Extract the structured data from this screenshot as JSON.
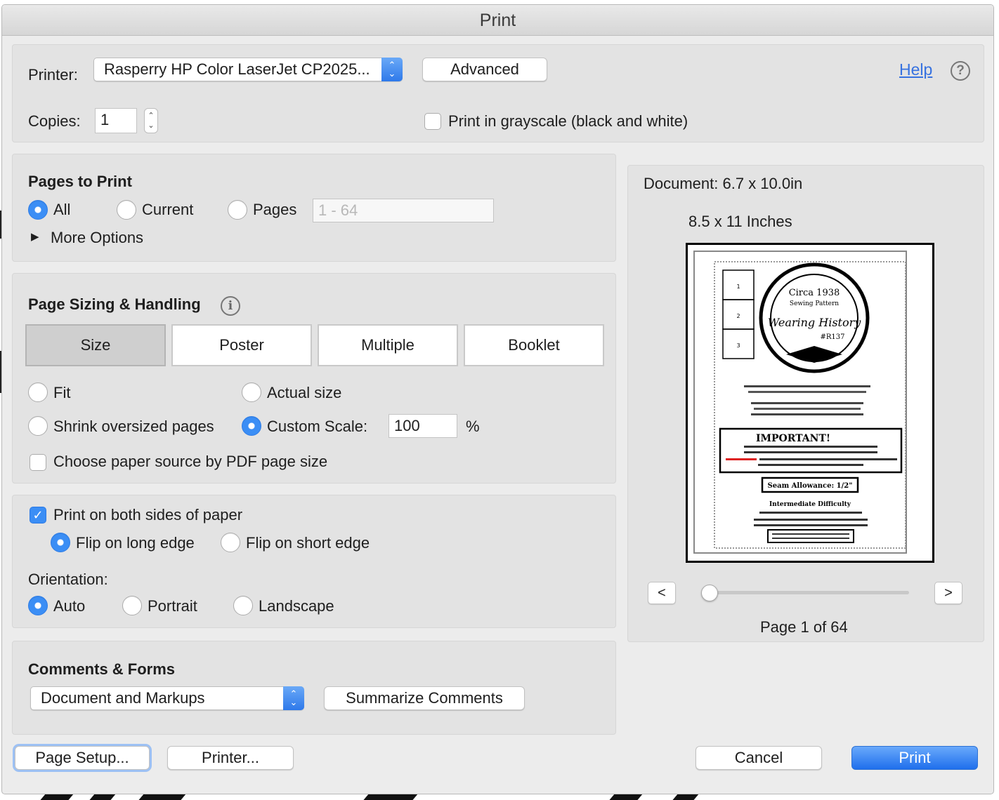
{
  "window": {
    "title": "Print"
  },
  "printer": {
    "label": "Printer:",
    "selected": "Rasperry HP Color LaserJet CP2025...",
    "advanced_label": "Advanced",
    "help_label": "Help",
    "copies_label": "Copies:",
    "copies_value": "1",
    "grayscale_label": "Print in grayscale (black and white)",
    "grayscale_checked": false
  },
  "pages_to_print": {
    "heading": "Pages to Print",
    "all_label": "All",
    "current_label": "Current",
    "pages_label": "Pages",
    "range_placeholder": "1 - 64",
    "selected": "All",
    "more_options_label": "More Options"
  },
  "sizing": {
    "heading": "Page Sizing & Handling",
    "tabs": [
      "Size",
      "Poster",
      "Multiple",
      "Booklet"
    ],
    "selected_tab": "Size",
    "fit_label": "Fit",
    "actual_size_label": "Actual size",
    "shrink_label": "Shrink oversized pages",
    "custom_scale_label": "Custom Scale:",
    "custom_scale_value": "100",
    "percent_sign": "%",
    "selected_option": "Custom Scale:",
    "paper_source_label": "Choose paper source by PDF page size",
    "paper_source_checked": false
  },
  "duplex": {
    "both_sides_label": "Print on both sides of paper",
    "both_sides_checked": true,
    "long_edge_label": "Flip on long edge",
    "short_edge_label": "Flip on short edge",
    "selected_flip": "Flip on long edge",
    "orientation_label": "Orientation:",
    "auto_label": "Auto",
    "portrait_label": "Portrait",
    "landscape_label": "Landscape",
    "selected_orientation": "Auto"
  },
  "comments": {
    "heading": "Comments & Forms",
    "selected": "Document and Markups",
    "summarize_label": "Summarize Comments"
  },
  "preview": {
    "document_size": "Document: 6.7 x 10.0in",
    "paper_size": "8.5 x 11 Inches",
    "page_status": "Page 1 of 64",
    "prev_label": "<",
    "next_label": ">",
    "current_page": 1,
    "total_pages": 64,
    "thumb": {
      "circa": "Circa 1938",
      "subtitle": "Sewing Pattern",
      "brand": "Wearing History",
      "number": "#R137",
      "important": "IMPORTANT!",
      "seam": "Seam Allowance: 1/2\"",
      "difficulty": "Intermediate Difficulty",
      "boxes": [
        "1",
        "2",
        "3"
      ]
    }
  },
  "footer": {
    "page_setup_label": "Page Setup...",
    "printer_label": "Printer...",
    "cancel_label": "Cancel",
    "print_label": "Print"
  },
  "colors": {
    "accent": "#3b8ef5",
    "link": "#3772e0",
    "panel": "#e3e3e3",
    "dialog": "#ececec"
  }
}
